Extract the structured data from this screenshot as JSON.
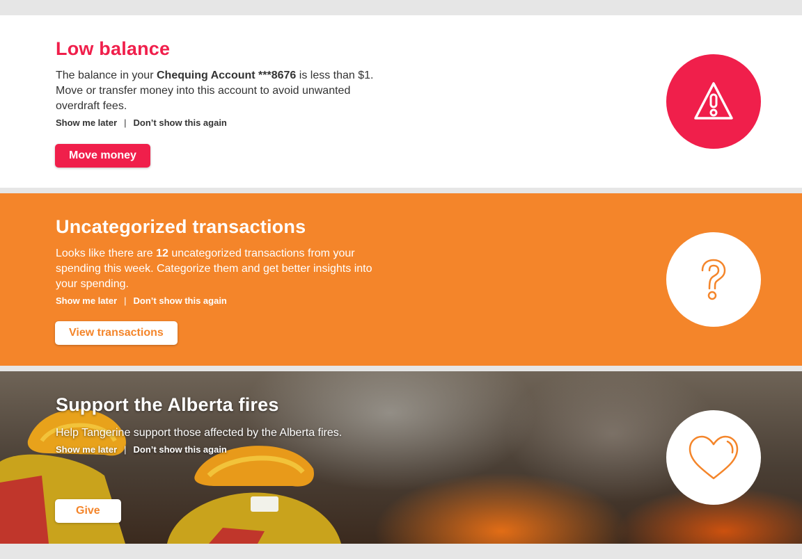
{
  "colors": {
    "brand_red": "#f01f4b",
    "brand_orange": "#f4852a",
    "page_bg": "#e6e6e6"
  },
  "cards": {
    "low_balance": {
      "title": "Low balance",
      "text_before": "The balance in your ",
      "account_name": "Chequing Account ***8676",
      "text_after": " is less than $1. Move or transfer money into this account to avoid unwanted overdraft fees.",
      "show_later": "Show me later",
      "separator": "|",
      "dont_show": "Don’t show this again",
      "button_label": "Move money",
      "icon": "warning-triangle-icon"
    },
    "uncategorized": {
      "title": "Uncategorized transactions",
      "text_before": "Looks like there are ",
      "count": "12",
      "text_after": " uncategorized transactions from your spending this week. Categorize them and get better insights into your spending.",
      "show_later": "Show me later",
      "separator": "|",
      "dont_show": "Don’t show this again",
      "button_label": "View transactions",
      "icon": "question-mark-icon"
    },
    "alberta_fires": {
      "title": "Support the Alberta fires",
      "description": "Help Tangerine support those affected by the Alberta fires.",
      "show_later": "Show me later",
      "separator": "|",
      "dont_show": "Don’t show this again",
      "button_label": "Give",
      "icon": "heart-icon",
      "background": "firefighters-wildfire-photo"
    }
  }
}
